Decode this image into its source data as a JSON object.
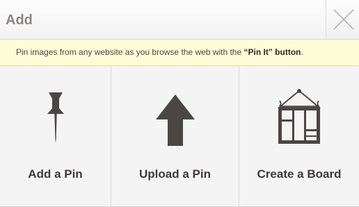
{
  "dialog": {
    "title": "Add",
    "close_icon": "close-icon"
  },
  "notice": {
    "text_before": "Pin images from any website as you browse the web with the ",
    "highlight": "“Pin It” button",
    "text_after": "."
  },
  "options": [
    {
      "label": "Add a Pin",
      "icon": "pushpin-icon"
    },
    {
      "label": "Upload a Pin",
      "icon": "upload-arrow-icon"
    },
    {
      "label": "Create a Board",
      "icon": "board-icon"
    }
  ],
  "colors": {
    "notice_background": "#fffdd7",
    "icon_color": "#4b4646",
    "label_color": "#3e3a3a"
  }
}
